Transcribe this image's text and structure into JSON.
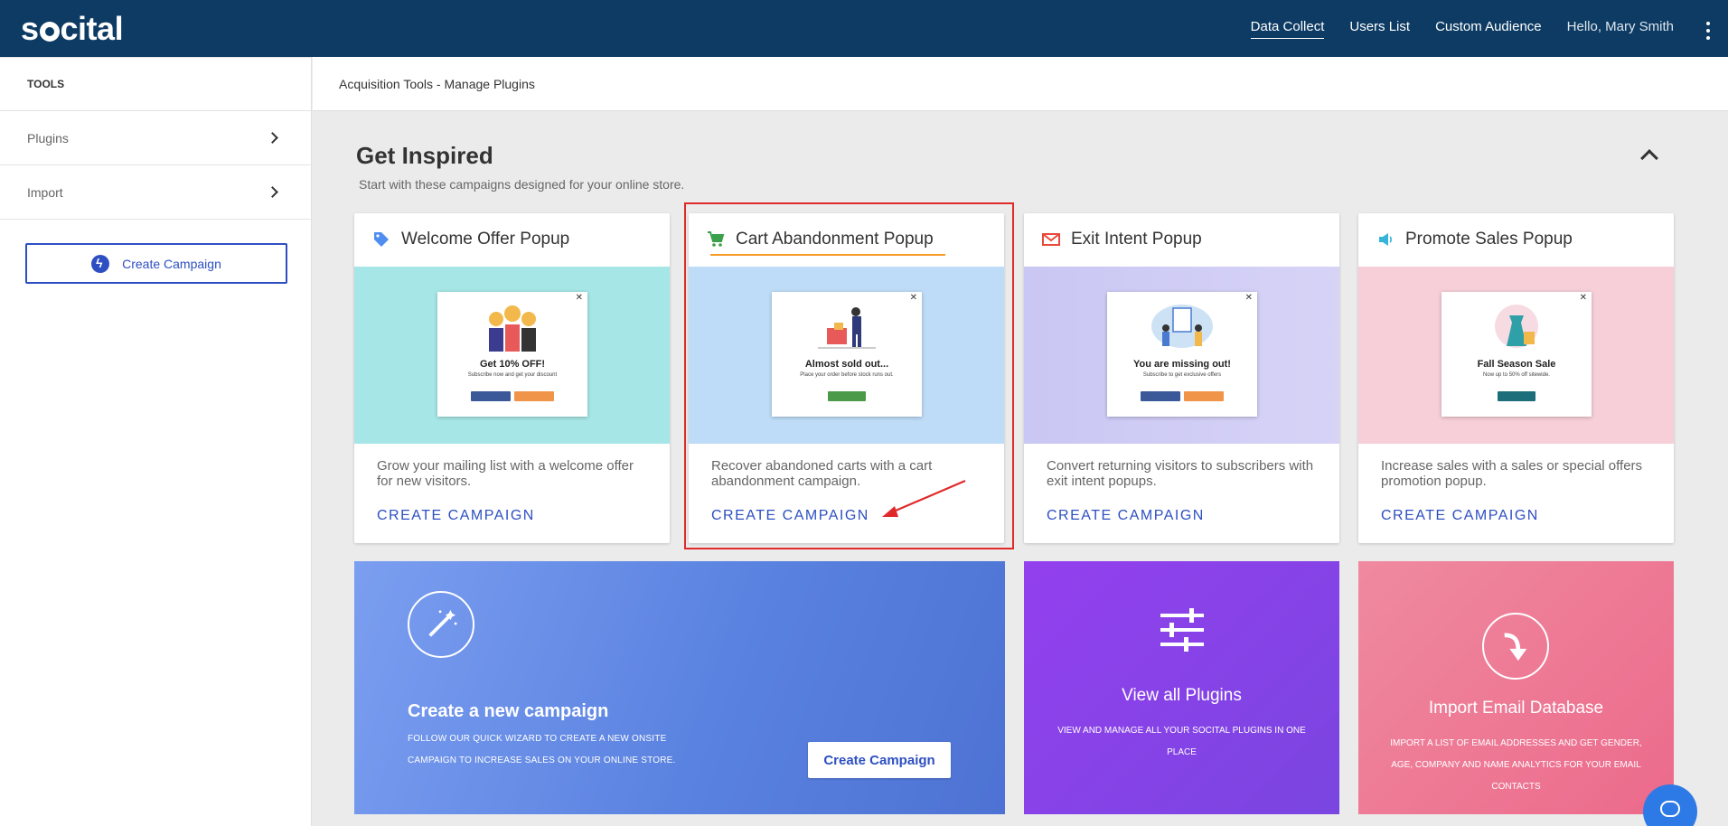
{
  "app": {
    "logo_text_1": "s",
    "logo_text_2": "cital"
  },
  "nav": {
    "items": [
      "Data Collect",
      "Users List",
      "Custom Audience"
    ],
    "greeting": "Hello, Mary Smith"
  },
  "sidebar": {
    "heading": "TOOLS",
    "items": [
      {
        "label": "Plugins"
      },
      {
        "label": "Import"
      }
    ],
    "create_button": "Create Campaign"
  },
  "breadcrumb": "Acquisition Tools - Manage Plugins",
  "section": {
    "title": "Get Inspired",
    "subtitle": "Start with these campaigns designed for your online store."
  },
  "cards": [
    {
      "title": "Welcome Offer Popup",
      "icon": "tag-icon",
      "icon_color": "#4f8ef0",
      "bg": "#a6e6e6",
      "mock_title": "Get 10% OFF!",
      "mock_sub": "Subscribe now and get your discount",
      "description": "Grow your mailing list with a welcome offer for new visitors.",
      "cta": "CREATE CAMPAIGN"
    },
    {
      "title": "Cart Abandonment Popup",
      "icon": "cart-icon",
      "icon_color": "#3aa04a",
      "bg": "#bedcf7",
      "mock_title": "Almost sold out...",
      "mock_sub": "Place your order before stock runs out.",
      "description": "Recover abandoned carts with a cart abandonment campaign.",
      "cta": "CREATE CAMPAIGN"
    },
    {
      "title": "Exit Intent Popup",
      "icon": "mail-icon",
      "icon_color": "#e8493a",
      "bg": "#d4d0f5",
      "mock_title": "You are missing out!",
      "mock_sub": "Subscribe to get exclusive offers",
      "description": "Convert returning visitors to subscribers with exit intent popups.",
      "cta": "CREATE CAMPAIGN"
    },
    {
      "title": "Promote Sales Popup",
      "icon": "megaphone-icon",
      "icon_color": "#36b4d9",
      "bg": "#f7cfd8",
      "mock_title": "Fall Season Sale",
      "mock_sub": "Now up to 50% off sitewide.",
      "description": "Increase sales with a sales or special offers promotion popup.",
      "cta": "CREATE CAMPAIGN"
    }
  ],
  "tiles": {
    "create": {
      "title": "Create a new campaign",
      "text": "FOLLOW OUR QUICK WIZARD TO CREATE A NEW ONSITE CAMPAIGN TO INCREASE SALES ON YOUR ONLINE STORE.",
      "button": "Create Campaign"
    },
    "plugins": {
      "title": "View all Plugins",
      "text": "VIEW AND MANAGE ALL YOUR SOCITAL PLUGINS IN ONE PLACE"
    },
    "import": {
      "title": "Import Email Database",
      "text": "IMPORT A LIST OF EMAIL ADDRESSES AND GET GENDER, AGE, COMPANY AND NAME ANALYTICS FOR YOUR EMAIL CONTACTS"
    }
  }
}
